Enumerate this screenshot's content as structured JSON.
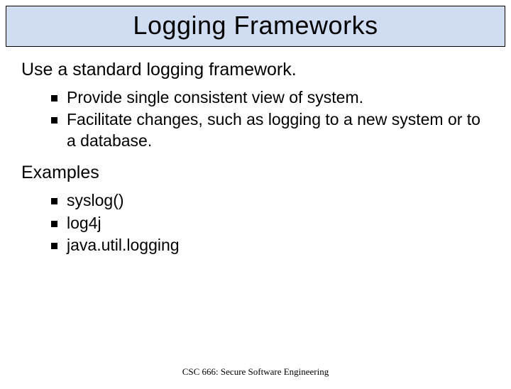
{
  "title": "Logging Frameworks",
  "intro": "Use a standard logging framework.",
  "intro_bullets": [
    "Provide single consistent view of system.",
    "Facilitate changes, such as logging to a new system or to a database."
  ],
  "examples_label": "Examples",
  "examples": [
    "syslog()",
    "log4j",
    "java.util.logging"
  ],
  "footer": "CSC 666: Secure Software Engineering"
}
